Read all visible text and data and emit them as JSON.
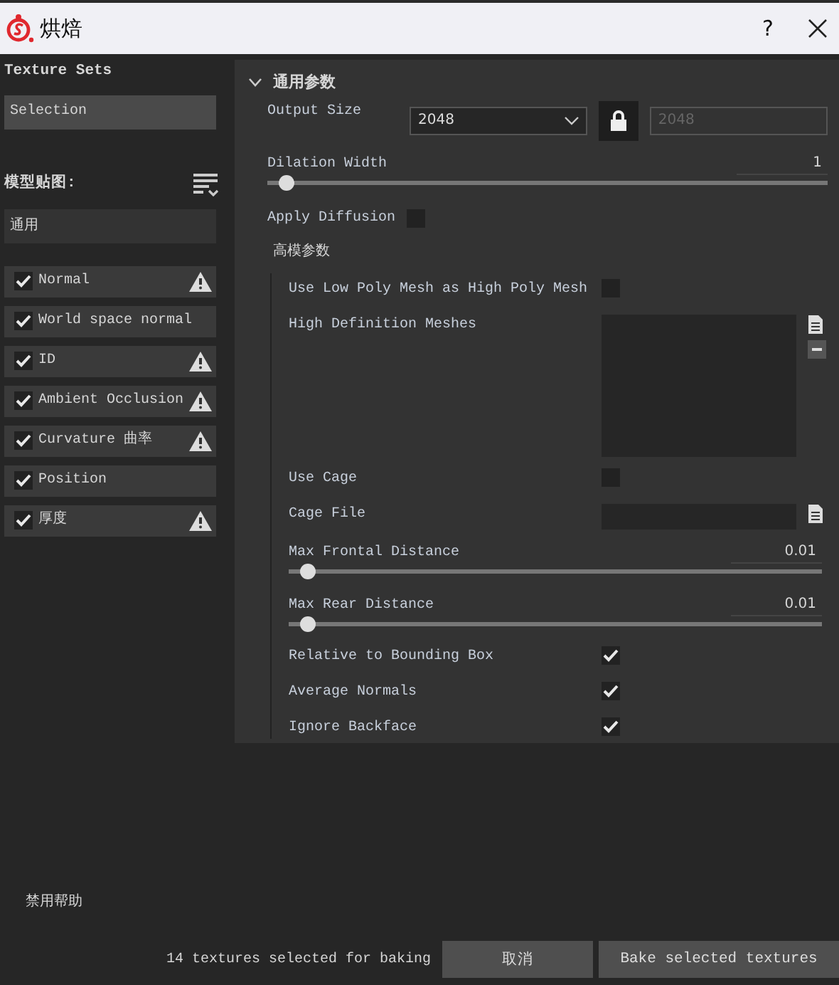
{
  "window": {
    "title": "烘焙",
    "help": "?"
  },
  "sidebar": {
    "texture_sets_label": "Texture Sets",
    "texture_set": "Selection",
    "maps_label": "模型贴图:",
    "filter": "通用",
    "maps": [
      {
        "label": "Normal",
        "checked": true,
        "warning": true
      },
      {
        "label": "World space normal",
        "checked": true,
        "warning": false
      },
      {
        "label": "ID",
        "checked": true,
        "warning": true
      },
      {
        "label": "Ambient Occlusion",
        "checked": true,
        "warning": true
      },
      {
        "label": "Curvature 曲率",
        "checked": true,
        "warning": true
      },
      {
        "label": "Position",
        "checked": true,
        "warning": false
      },
      {
        "label": "厚度",
        "checked": true,
        "warning": true
      }
    ]
  },
  "general": {
    "title": "通用参数",
    "expanded": true,
    "output_size": {
      "label": "Output Size",
      "value": "2048",
      "locked": true,
      "linked_value": "2048"
    },
    "dilation": {
      "label": "Dilation Width",
      "reading": "1",
      "level": 0.02
    },
    "apply_diffusion": {
      "label": "Apply Diffusion",
      "checked": false
    },
    "high_poly": {
      "title": "高模参数",
      "rows": [
        {
          "kind": "checkbox",
          "label": "Use Low Poly Mesh as High Poly Mesh",
          "checked": false
        },
        {
          "kind": "list",
          "label": "High Definition Meshes"
        },
        {
          "kind": "checkbox",
          "label": "Use Cage",
          "checked": false
        },
        {
          "kind": "file",
          "label": "Cage File"
        },
        {
          "kind": "slider",
          "label": "Max Frontal Distance",
          "reading": "0.01",
          "level": 0.02
        },
        {
          "kind": "slider",
          "label": "Max Rear Distance",
          "reading": "0.01",
          "level": 0.02
        },
        {
          "kind": "checkbox",
          "label": "Relative to Bounding Box",
          "checked": true
        },
        {
          "kind": "checkbox",
          "label": "Average Normals",
          "checked": true
        },
        {
          "kind": "checkbox",
          "label": "Ignore Backface",
          "checked": true
        }
      ]
    }
  },
  "footer": {
    "disable_help": "禁用帮助",
    "status": "14 textures selected for baking",
    "buttons": [
      "取消",
      "Bake selected textures"
    ]
  }
}
